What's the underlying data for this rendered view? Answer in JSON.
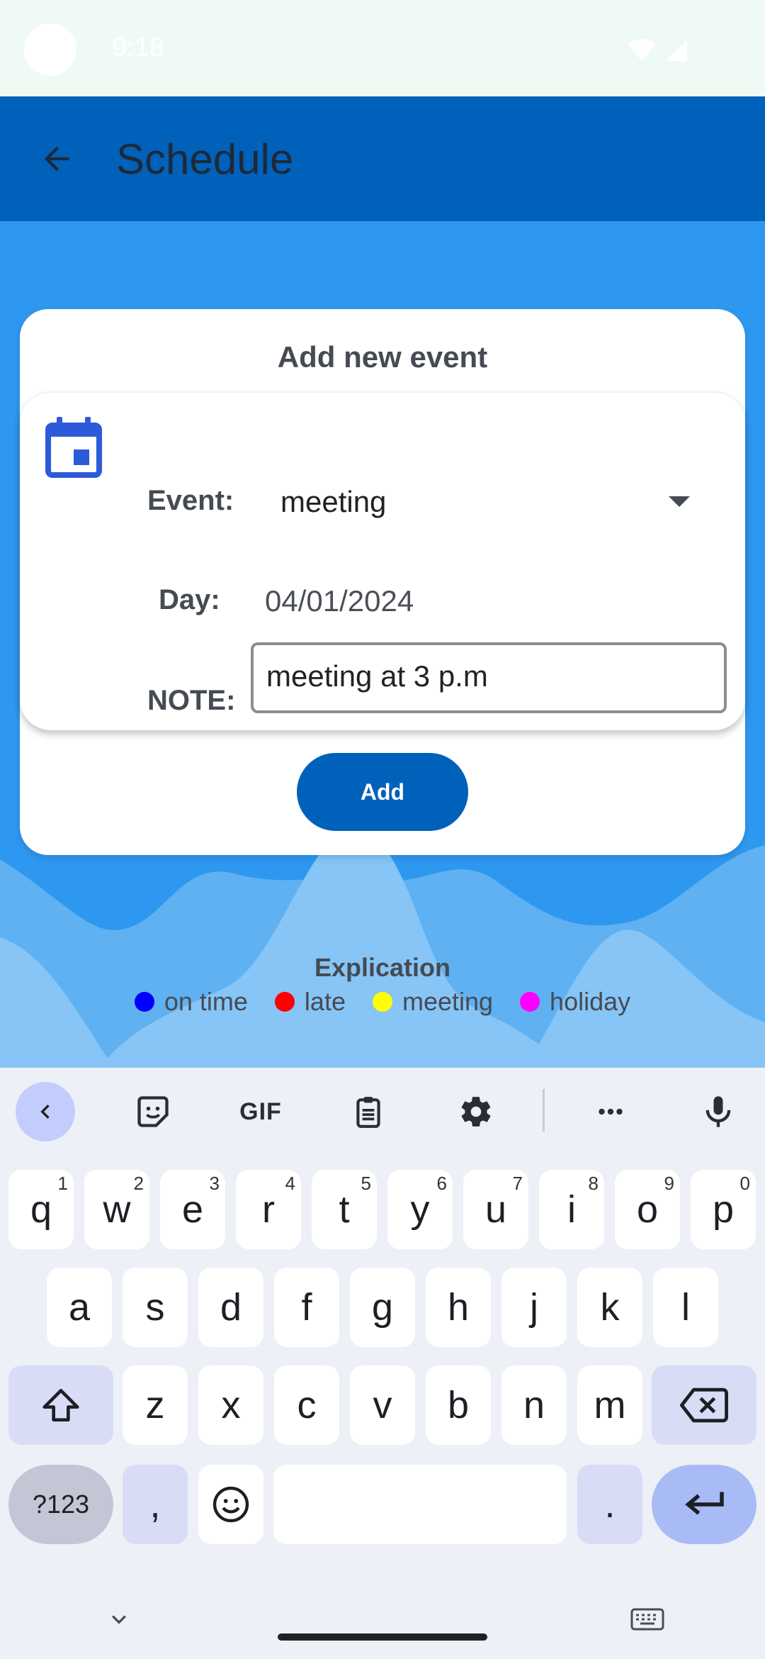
{
  "status_bar": {
    "time": "9:18"
  },
  "app_bar": {
    "title": "Schedule"
  },
  "dialog": {
    "title": "Add new event",
    "event_label": "Event:",
    "event_value": "meeting",
    "day_label": "Day:",
    "day_value": "04/01/2024",
    "note_label": "NOTE:",
    "note_value": "meeting at 3 p.m",
    "add_label": "Add"
  },
  "legend": {
    "title": "Explication",
    "items": [
      {
        "label": "on time",
        "color": "#0000ff"
      },
      {
        "label": "late",
        "color": "#ff0000"
      },
      {
        "label": "meeting",
        "color": "#ffff00"
      },
      {
        "label": "holiday",
        "color": "#ff00ff"
      }
    ]
  },
  "keyboard": {
    "toolbar": [
      "collapse-icon",
      "sticker-icon",
      "GIF",
      "clipboard-icon",
      "settings-icon",
      "more-icon",
      "mic-icon"
    ],
    "row1": [
      {
        "key": "q",
        "hint": "1"
      },
      {
        "key": "w",
        "hint": "2"
      },
      {
        "key": "e",
        "hint": "3"
      },
      {
        "key": "r",
        "hint": "4"
      },
      {
        "key": "t",
        "hint": "5"
      },
      {
        "key": "y",
        "hint": "6"
      },
      {
        "key": "u",
        "hint": "7"
      },
      {
        "key": "i",
        "hint": "8"
      },
      {
        "key": "o",
        "hint": "9"
      },
      {
        "key": "p",
        "hint": "0"
      }
    ],
    "row2": [
      "a",
      "s",
      "d",
      "f",
      "g",
      "h",
      "j",
      "k",
      "l"
    ],
    "row3": [
      "z",
      "x",
      "c",
      "v",
      "b",
      "n",
      "m"
    ],
    "symbols_key": "?123",
    "comma_key": ",",
    "period_key": "."
  },
  "colors": {
    "primary": "#0061bb",
    "background": "#2e98f0",
    "calendar_icon": "#2d5ad8"
  }
}
